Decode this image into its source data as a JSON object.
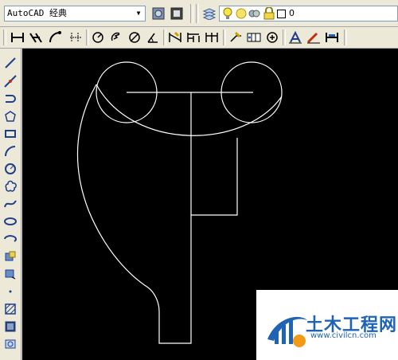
{
  "toolbar": {
    "workspace_value": "AutoCAD 经典",
    "workspace_arrow": "▼",
    "layer_name": "0",
    "icons_row1": [
      "workspace-settings-icon",
      "customize-icon",
      "layer-manager-icon",
      "lightbulb-icon",
      "sun-icon",
      "printer-icon",
      "lock-icon",
      "color-swatch-icon"
    ],
    "icons_row2": [
      "linear-dimension-icon",
      "aligned-dimension-icon",
      "arc-length-icon",
      "ordinate-dimension-icon",
      "radius-dimension-icon",
      "jogged-dimension-icon",
      "diameter-dimension-icon",
      "angular-dimension-icon",
      "quick-dimension-icon",
      "baseline-dimension-icon",
      "continue-dimension-icon",
      "quick-leader-icon",
      "tolerance-icon",
      "center-mark-icon",
      "dimension-edit-icon",
      "dimension-text-edit-icon",
      "dimension-update-icon"
    ]
  },
  "draw_toolbar": {
    "icons": [
      "line-icon",
      "construction-line-icon",
      "polyline-icon",
      "polygon-icon",
      "rectangle-icon",
      "arc-icon",
      "circle-icon",
      "revision-cloud-icon",
      "spline-icon",
      "ellipse-icon",
      "ellipse-arc-icon",
      "insert-block-icon",
      "make-block-icon",
      "point-icon",
      "hatch-icon",
      "gradient-icon",
      "region-icon"
    ]
  },
  "colors": {
    "canvas_bg": "#000000",
    "drawing_lines": "#ffffff",
    "toolbar_bg": "#ece9d8",
    "watermark_blue": "#1e63b4"
  },
  "watermark": {
    "title": "土木工程网",
    "url": "www.civilcn.com"
  }
}
